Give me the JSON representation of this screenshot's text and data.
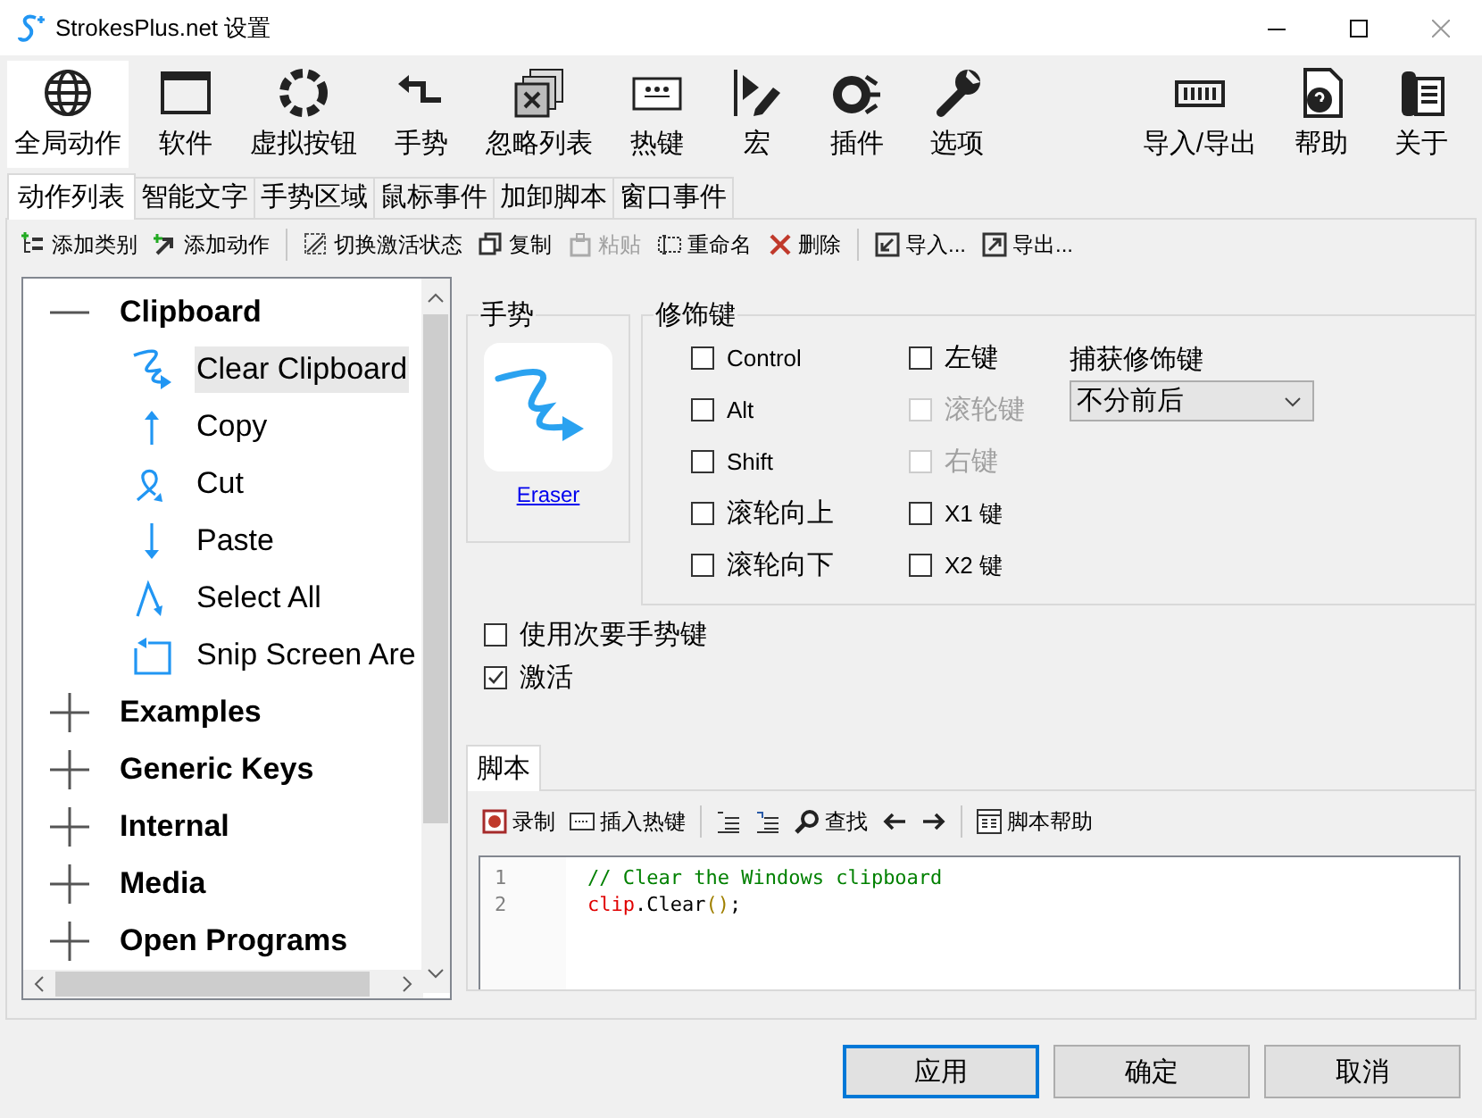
{
  "window": {
    "title": "StrokesPlus.net 设置"
  },
  "toolbar": {
    "left": [
      {
        "label": "全局动作",
        "selected": true
      },
      {
        "label": "软件",
        "selected": false
      },
      {
        "label": "虚拟按钮",
        "selected": false
      },
      {
        "label": "手势",
        "selected": false
      },
      {
        "label": "忽略列表",
        "selected": false
      },
      {
        "label": "热键",
        "selected": false
      },
      {
        "label": "宏",
        "selected": false
      },
      {
        "label": "插件",
        "selected": false
      },
      {
        "label": "选项",
        "selected": false
      }
    ],
    "right": [
      {
        "label": "导入/导出",
        "selected": false
      },
      {
        "label": "帮助",
        "selected": false
      },
      {
        "label": "关于",
        "selected": false
      }
    ]
  },
  "tabs": [
    {
      "label": "动作列表",
      "selected": true
    },
    {
      "label": "智能文字",
      "selected": false
    },
    {
      "label": "手势区域",
      "selected": false
    },
    {
      "label": "鼠标事件",
      "selected": false
    },
    {
      "label": "加卸脚本",
      "selected": false
    },
    {
      "label": "窗口事件",
      "selected": false
    }
  ],
  "action_toolbar": {
    "groups": [
      [
        {
          "label": "添加类别",
          "disabled": false
        },
        {
          "label": "添加动作",
          "disabled": false
        }
      ],
      [
        {
          "label": "切换激活状态",
          "disabled": false
        },
        {
          "label": "复制",
          "disabled": false
        },
        {
          "label": "粘贴",
          "disabled": true
        },
        {
          "label": "重命名",
          "disabled": false
        },
        {
          "label": "删除",
          "disabled": false
        }
      ],
      [
        {
          "label": "导入...",
          "disabled": false
        },
        {
          "label": "导出...",
          "disabled": false
        }
      ]
    ]
  },
  "tree": {
    "categories": [
      {
        "label": "Clipboard",
        "expanded": true,
        "children": [
          {
            "label": "Clear Clipboard",
            "selected": true
          },
          {
            "label": "Copy",
            "selected": false
          },
          {
            "label": "Cut",
            "selected": false
          },
          {
            "label": "Paste",
            "selected": false
          },
          {
            "label": "Select All",
            "selected": false
          },
          {
            "label": "Snip Screen Are",
            "selected": false
          }
        ]
      },
      {
        "label": "Examples",
        "expanded": false
      },
      {
        "label": "Generic Keys",
        "expanded": false
      },
      {
        "label": "Internal",
        "expanded": false
      },
      {
        "label": "Media",
        "expanded": false
      },
      {
        "label": "Open Programs",
        "expanded": false
      }
    ]
  },
  "gesture": {
    "heading": "手势",
    "name": "Eraser"
  },
  "modifiers": {
    "heading": "修饰键",
    "options": [
      {
        "label": "Control",
        "checked": false,
        "disabled": false
      },
      {
        "label": "Alt",
        "checked": false,
        "disabled": false
      },
      {
        "label": "Shift",
        "checked": false,
        "disabled": false
      },
      {
        "label": "滚轮向上",
        "checked": false,
        "disabled": false
      },
      {
        "label": "滚轮向下",
        "checked": false,
        "disabled": false
      },
      {
        "label": "左键",
        "checked": false,
        "disabled": false
      },
      {
        "label": "滚轮键",
        "checked": false,
        "disabled": true
      },
      {
        "label": "右键",
        "checked": false,
        "disabled": true
      },
      {
        "label": "X1 键",
        "checked": false,
        "disabled": false
      },
      {
        "label": "X2 键",
        "checked": false,
        "disabled": false
      }
    ],
    "capture": {
      "label": "捕获修饰键",
      "value": "不分前后"
    }
  },
  "options": [
    {
      "label": "使用次要手势键",
      "checked": false
    },
    {
      "label": "激活",
      "checked": true
    }
  ],
  "script": {
    "tab": "脚本",
    "toolbar": {
      "record": "录制",
      "insert_hotkey": "插入热键",
      "find": "查找",
      "script_help": "脚本帮助"
    },
    "lines": [
      {
        "number": "1",
        "tokens": [
          {
            "text": "// Clear the Windows clipboard",
            "kind": "comment"
          }
        ]
      },
      {
        "number": "2",
        "tokens": [
          {
            "text": "clip",
            "kind": "object"
          },
          {
            "text": ".Clear",
            "kind": "plain"
          },
          {
            "text": "()",
            "kind": "paren"
          },
          {
            "text": ";",
            "kind": "plain"
          }
        ]
      }
    ]
  },
  "buttons": [
    {
      "label": "应用",
      "default": true
    },
    {
      "label": "确定",
      "default": false
    },
    {
      "label": "取消",
      "default": false
    }
  ]
}
